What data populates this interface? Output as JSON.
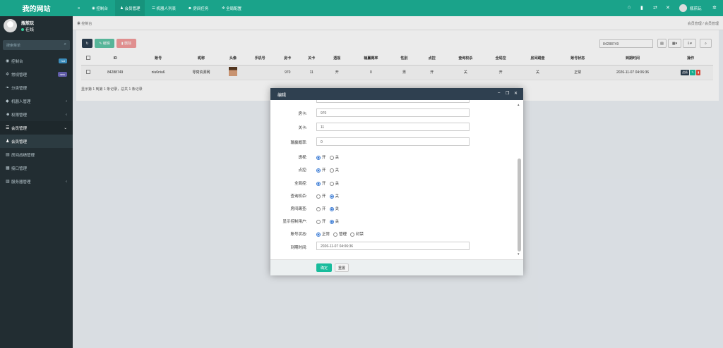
{
  "app": {
    "title": "我的网站"
  },
  "user": {
    "name": "瓶煎玩",
    "status": "在线"
  },
  "search": {
    "placeholder": "搜索菜单"
  },
  "sidebar": {
    "items": [
      {
        "label": "控制台",
        "badge": "hot",
        "badge_color": "#3c8dbc"
      },
      {
        "label": "常规管理",
        "badge": "new",
        "badge_color": "#605ca8"
      },
      {
        "label": "分类管理"
      },
      {
        "label": "机器人管理"
      },
      {
        "label": "权限管理"
      },
      {
        "label": "会员管理"
      },
      {
        "label": "会员管理"
      },
      {
        "label": "房间战绩管理"
      },
      {
        "label": "接口管理"
      },
      {
        "label": "服务器管理"
      }
    ]
  },
  "topnav": {
    "items": [
      "控制台",
      "会员管理",
      "机器人列表",
      "房间任务",
      "全局配置"
    ]
  },
  "breadcrumb": {
    "left": "控制台",
    "right1": "会员管理",
    "sep": "/",
    "right2": "会员管理"
  },
  "toolbar": {
    "edit": "编辑",
    "delete": "删除",
    "search_value": "84288749",
    "colors": {
      "refresh": "#2c3e50",
      "edit": "#5fc5a6",
      "delete": "#f39c9c"
    }
  },
  "table": {
    "headers": [
      "ID",
      "账号",
      "昵称",
      "头像",
      "手机号",
      "房卡",
      "关卡",
      "透视",
      "输赢概率",
      "性别",
      "点控",
      "查询权杀",
      "全局控",
      "房间踢查",
      "账号状态",
      "到期时间",
      "操作"
    ],
    "rows": [
      {
        "id": "84288749",
        "account": "niu6niu6",
        "nick": "零窝资源网",
        "phone": "",
        "fangka": "970",
        "guanka": "11",
        "toushi": "开",
        "prob": "0",
        "gender": "男",
        "diankong": "开",
        "chaxun": "关",
        "quanju": "开",
        "fangjian": "关",
        "status": "正常",
        "expire": "2026-11-07 04:06:36",
        "action1": "战绩"
      }
    ]
  },
  "summary": "显示第 1 到第 1 条记录，总共 1 条记录",
  "dialog": {
    "title": "编辑",
    "fields": [
      {
        "label": "房卡:",
        "value": "970"
      },
      {
        "label": "关卡:",
        "value": "11"
      },
      {
        "label": "输赢概率:",
        "value": "0"
      }
    ],
    "radios": [
      {
        "label": "透视:",
        "options": [
          "开",
          "关"
        ],
        "selected": 0
      },
      {
        "label": "点控:",
        "options": [
          "开",
          "关"
        ],
        "selected": 0
      },
      {
        "label": "全局控:",
        "options": [
          "开",
          "关"
        ],
        "selected": 0
      },
      {
        "label": "查询权杀:",
        "options": [
          "开",
          "关"
        ],
        "selected": 1
      },
      {
        "label": "房间踢查:",
        "options": [
          "开",
          "关"
        ],
        "selected": 1
      },
      {
        "label": "显示控制用户:",
        "options": [
          "开",
          "关"
        ],
        "selected": 1
      },
      {
        "label": "账号状态:",
        "options": [
          "正常",
          "管理",
          "封禁"
        ],
        "selected": 0
      }
    ],
    "expire_label": "到期时间:",
    "expire_value": "2026-11-07 04:06:36",
    "ok": "确定",
    "reset": "重置"
  }
}
